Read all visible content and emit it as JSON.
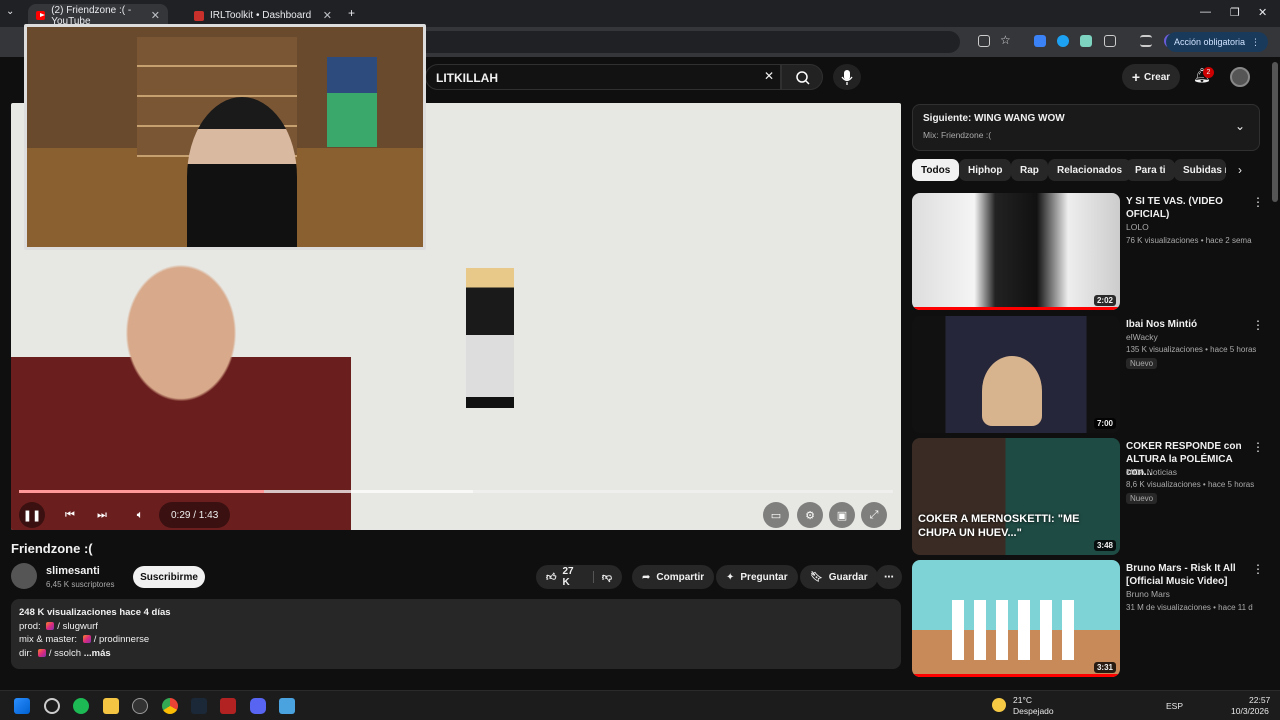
{
  "browser": {
    "tabs": [
      {
        "title": "(2) Friendzone :( - YouTube"
      },
      {
        "title": "IRLToolkit • Dashboard"
      }
    ],
    "url_fragment": "=1",
    "action_chip": "Acción obligatoria",
    "profile_initial": "I"
  },
  "header": {
    "search_value": "LITKILLAH",
    "create_label": "Crear",
    "notif_count": "2"
  },
  "player": {
    "time": "0:29 / 1:43",
    "progress": 0.28,
    "buffered": 0.52
  },
  "video": {
    "title": "Friendzone :(",
    "channel": "slimesanti",
    "subscribers": "6,45 K suscriptores",
    "subscribe_label": "Suscribirme",
    "likes": "27 K",
    "share_label": "Compartir",
    "ask_label": "Preguntar",
    "save_label": "Guardar"
  },
  "description": {
    "stats": "248 K visualizaciones  hace 4 días",
    "lines": [
      {
        "prefix": "prod: ",
        "handle": "/ slugwurf"
      },
      {
        "prefix": "mix & master: ",
        "handle": "/ prodinnerse"
      },
      {
        "prefix": "dir: ",
        "handle": "/ ssolch"
      }
    ],
    "more": "...más"
  },
  "upnext": {
    "label": "Siguiente:",
    "next_title": "WING WANG WOW",
    "mix": "Mix: Friendzone :("
  },
  "chips": [
    "Todos",
    "Hiphop",
    "Rap",
    "Relacionados",
    "Para ti",
    "Subidas re"
  ],
  "recommendations": [
    {
      "title": "Y SI TE VAS. (VIDEO OFICIAL)",
      "channel": "LOLO",
      "meta": "76 K visualizaciones • hace 2 sema",
      "duration": "2:02",
      "nuevo": ""
    },
    {
      "title": "Ibai Nos Mintió",
      "channel": "elWacky",
      "meta": "135 K visualizaciones • hace 5 horas",
      "duration": "7:00",
      "nuevo": "Nuevo"
    },
    {
      "title": "COKER RESPONDE con ALTURA la POLÉMICA con...",
      "channel": "MDA Noticias",
      "meta": "8,6 K visualizaciones • hace 5 horas",
      "duration": "3:48",
      "nuevo": "Nuevo",
      "thumb_text": "COKER A MERNOSKETTI: \"ME CHUPA UN HUEV...\""
    },
    {
      "title": "Bruno Mars - Risk It All [Official Music Video]",
      "channel": "Bruno Mars",
      "meta": "31 M de visualizaciones • hace 11 d",
      "duration": "3:31",
      "nuevo": ""
    }
  ],
  "taskbar": {
    "weather_temp": "21°C",
    "weather_desc": "Despejado",
    "lang": "ESP",
    "time": "22:57",
    "date": "10/3/2026"
  },
  "colors": {
    "accent_red": "#ff0000",
    "bg": "#0f0f0f",
    "chip_selected": "#f1f1f1"
  }
}
